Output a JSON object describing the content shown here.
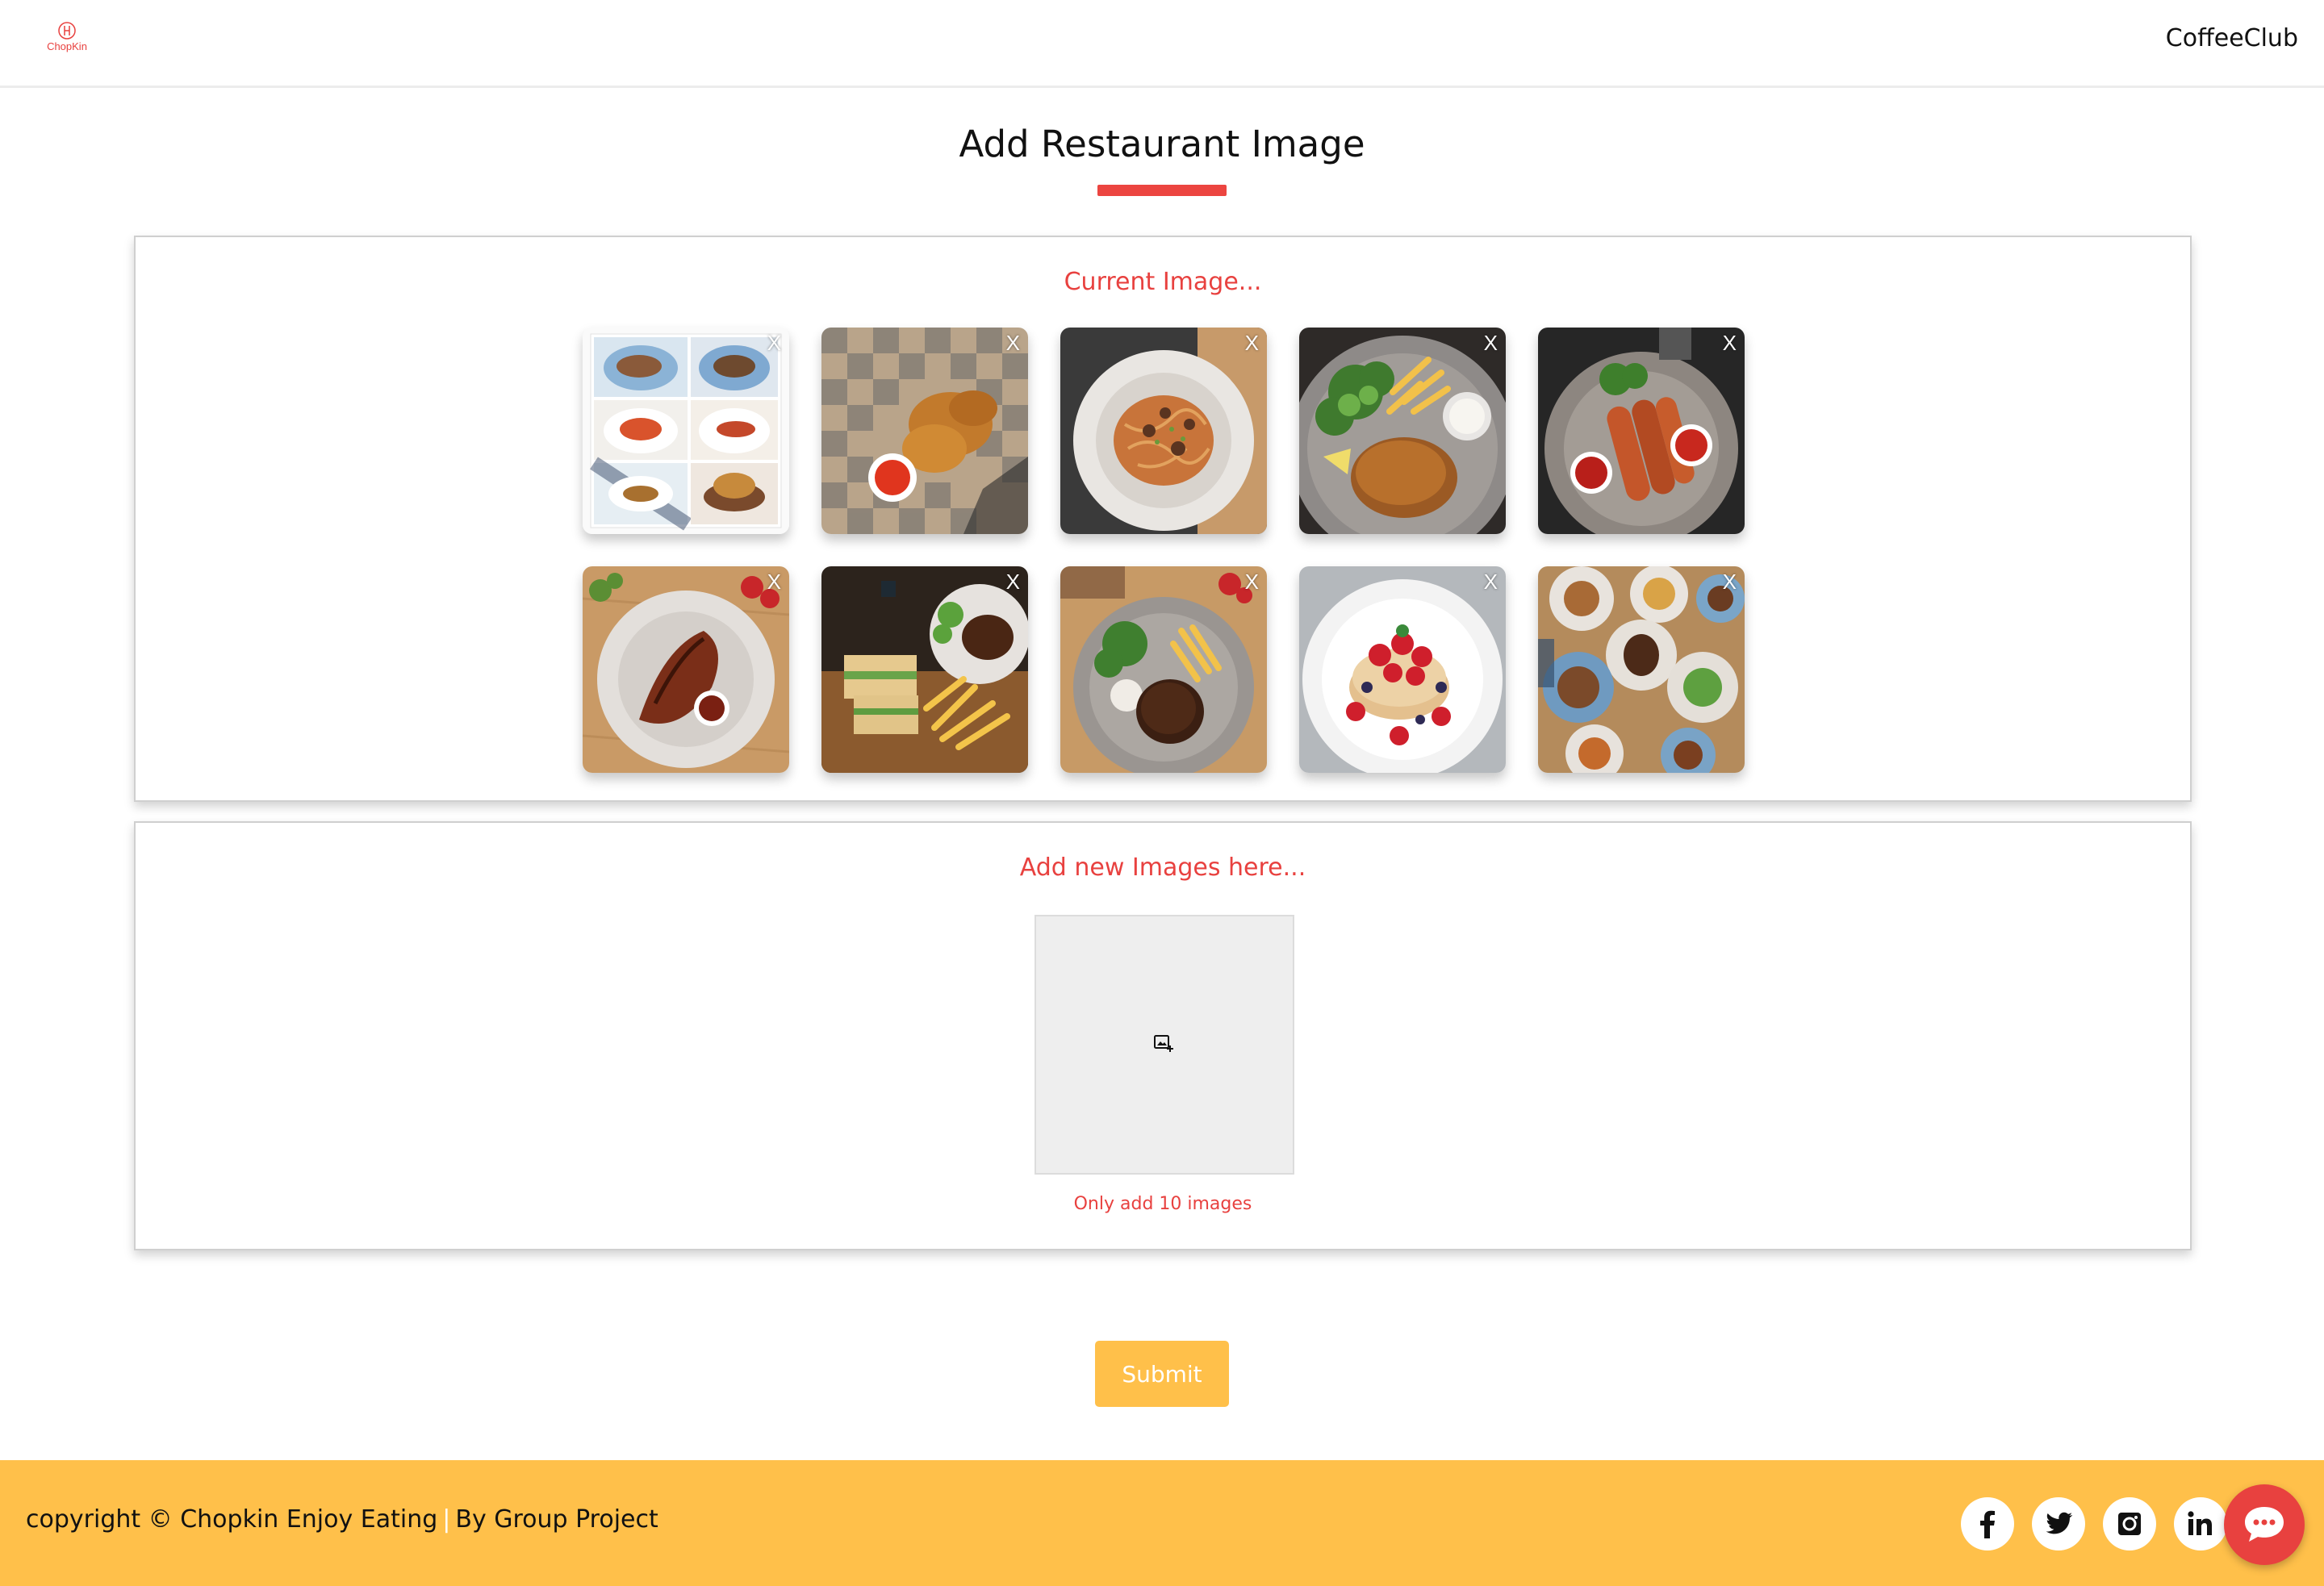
{
  "header": {
    "logo_text": "ChopKin",
    "user_name": "CoffeeClub"
  },
  "page_title": "Add Restaurant Image",
  "current_section": {
    "heading": "Current Image...",
    "remove_label": "X",
    "images": [
      {
        "name": "menu-board"
      },
      {
        "name": "fried-chicken-basket"
      },
      {
        "name": "pasta-bowl"
      },
      {
        "name": "schnitzel-fries"
      },
      {
        "name": "sausages-plate"
      },
      {
        "name": "glazed-chicken"
      },
      {
        "name": "steak-sandwich"
      },
      {
        "name": "steak-fries"
      },
      {
        "name": "berry-pancakes"
      },
      {
        "name": "table-spread"
      }
    ]
  },
  "new_section": {
    "heading": "Add new Images here...",
    "note": "Only add 10 images",
    "upload_icon": "add-photo-icon"
  },
  "submit_label": "Submit",
  "footer": {
    "copyright": "copyright © Chopkin Enjoy Eating",
    "separator": "|",
    "by": "By Group Project",
    "social": [
      "facebook-icon",
      "twitter-icon",
      "instagram-icon",
      "linkedin-icon"
    ]
  },
  "colors": {
    "accent_red": "#e8413f",
    "accent_yellow": "#ffc04a"
  }
}
